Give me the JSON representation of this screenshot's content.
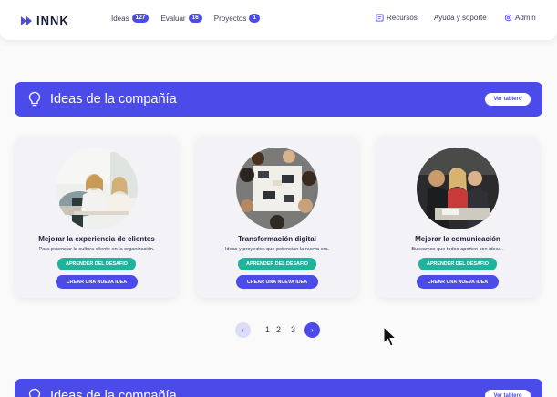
{
  "header": {
    "logo_text": "INNK",
    "nav": [
      {
        "label": "Ideas",
        "badge": "127"
      },
      {
        "label": "Evaluar",
        "badge": "16"
      },
      {
        "label": "Proyectos",
        "badge": "1"
      }
    ],
    "resources_label": "Recursos",
    "help_label": "Ayuda y soporte",
    "admin_label": "Admin"
  },
  "section": {
    "title": "Ideas de la compañía",
    "view_board_label": "Ver tablero"
  },
  "cards": [
    {
      "title": "Mejorar la experiencia de clientes",
      "description": "Para potenciar la cultura cliente en la organización.",
      "learn_label": "APRENDER DEL DESAFIO",
      "create_label": "CREAR UNA NUEVA IDEA"
    },
    {
      "title": "Transformación digital",
      "description": "Ideas y proyectos que potencian la nueva era.",
      "learn_label": "APRENDER DEL DESAFIO",
      "create_label": "CREAR UNA NUEVA IDEA"
    },
    {
      "title": "Mejorar la comunicación",
      "description": "Buscamos que todos aporten con ideas .",
      "learn_label": "APRENDER DEL DESAFIO",
      "create_label": "CREAR UNA NUEVA IDEA"
    }
  ],
  "pagination": {
    "pages": [
      "1",
      "2",
      "3"
    ],
    "separator": "·",
    "prev_icon": "‹",
    "next_icon": "›"
  },
  "section2": {
    "title": "Ideas de la compañía",
    "view_board_label": "Ver tablero"
  },
  "colors": {
    "primary": "#4b4bea",
    "green": "#1fb39c",
    "background": "#fafafa"
  }
}
